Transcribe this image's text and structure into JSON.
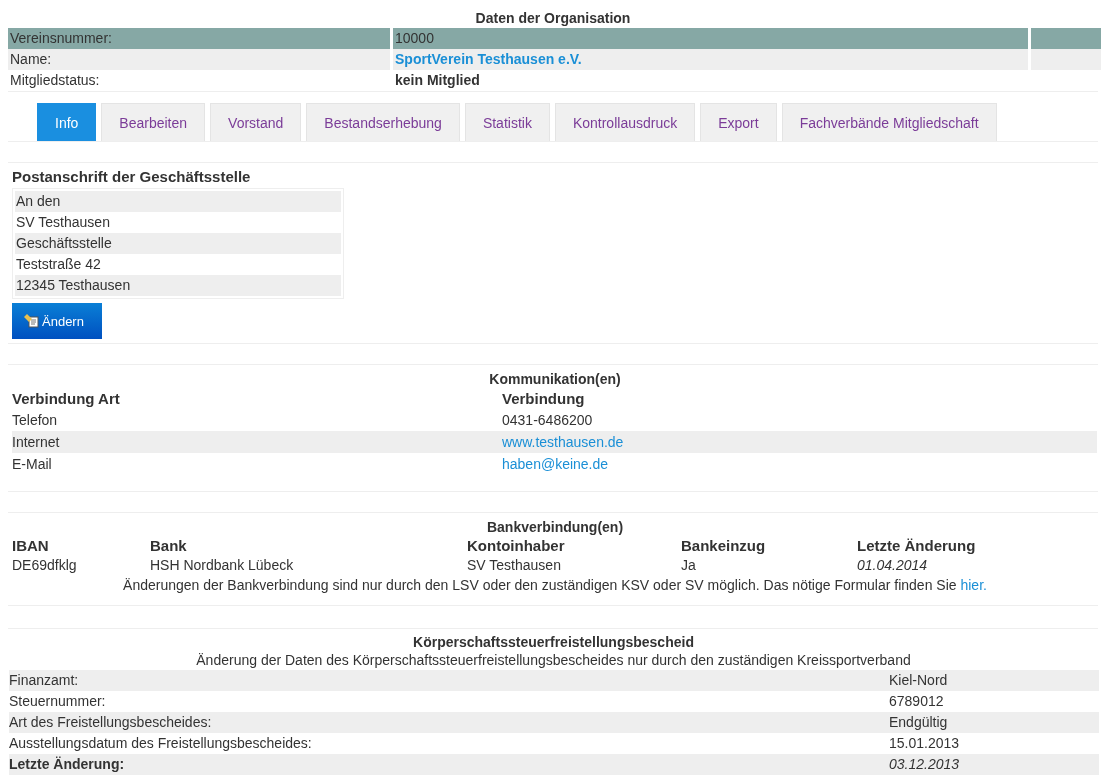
{
  "organisation": {
    "title": "Daten der Organisation",
    "fields": [
      {
        "label": "Vereinsnummer:",
        "value": "10000",
        "kind": "highlight"
      },
      {
        "label": "Name:",
        "value": "SportVerein Testhausen e.V.",
        "kind": "link"
      },
      {
        "label": "Mitgliedstatus:",
        "value": "kein Mitglied",
        "kind": "bold"
      }
    ]
  },
  "tabs": [
    {
      "label": "Info",
      "selected": true
    },
    {
      "label": "Bearbeiten",
      "selected": false
    },
    {
      "label": "Vorstand",
      "selected": false
    },
    {
      "label": "Bestandserhebung",
      "selected": false
    },
    {
      "label": "Statistik",
      "selected": false
    },
    {
      "label": "Kontrollausdruck",
      "selected": false
    },
    {
      "label": "Export",
      "selected": false
    },
    {
      "label": "Fachverbände Mitgliedschaft",
      "selected": false
    }
  ],
  "address": {
    "title": "Postanschrift der Geschäftsstelle",
    "lines": [
      "An den",
      "SV Testhausen",
      "Geschäftsstelle",
      "Teststraße 42",
      "12345 Testhausen"
    ],
    "button": "Ändern"
  },
  "communication": {
    "title": "Kommunikation(en)",
    "columns": [
      "Verbindung Art",
      "Verbindung"
    ],
    "rows": [
      {
        "type": "Telefon",
        "value": "0431-6486200",
        "kind": "text"
      },
      {
        "type": "Internet",
        "value": "www.testhausen.de",
        "kind": "link"
      },
      {
        "type": "E-Mail",
        "value": "haben@keine.de",
        "kind": "link"
      }
    ]
  },
  "bank": {
    "title": "Bankverbindung(en)",
    "columns": [
      "IBAN",
      "Bank",
      "Kontoinhaber",
      "Bankeinzug",
      "Letzte Änderung"
    ],
    "rows": [
      [
        "DE69dfklg",
        "HSH Nordbank Lübeck",
        "SV Testhausen",
        "Ja",
        "01.04.2014"
      ]
    ],
    "note": "Änderungen der Bankverbindung sind nur durch den LSV oder den zuständigen KSV oder SV möglich. Das nötige Formular finden Sie",
    "note_link": "hier."
  },
  "tax": {
    "title": "Körperschaftssteuerfreistellungsbescheid",
    "subtitle": "Änderung der Daten des Körperschaftssteuerfreistellungsbescheides nur durch den zuständigen Kreissportverband",
    "rows": [
      {
        "label": "Finanzamt:",
        "value": "Kiel-Nord",
        "kind": "plain"
      },
      {
        "label": "Steuernummer:",
        "value": "6789012",
        "kind": "plain"
      },
      {
        "label": "Art des Freistellungsbescheides:",
        "value": "Endgültig",
        "kind": "plain"
      },
      {
        "label": "Ausstellungsdatum des Freistellungsbescheides:",
        "value": "15.01.2013",
        "kind": "plain"
      },
      {
        "label": "Letzte Änderung:",
        "value": "03.12.2013",
        "kind": "changed"
      }
    ]
  }
}
